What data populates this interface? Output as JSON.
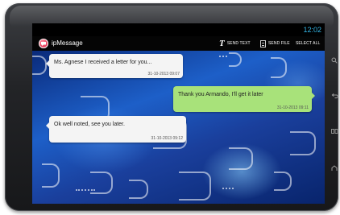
{
  "status_bar": {
    "time": "12:02"
  },
  "action_bar": {
    "title": "ipMessage",
    "send_text": "SEND TEXT",
    "send_file": "SEND FILE",
    "select_all": "SELECT ALL"
  },
  "messages": [
    {
      "direction": "incoming",
      "text": "Ms. Agnese I received a letter for you...",
      "time": "31-10-2013  09:07"
    },
    {
      "direction": "outgoing",
      "text": "Thank you Armando, I'll get it later",
      "time": "31-10-2013  09:11"
    },
    {
      "direction": "incoming",
      "text": "Ok well noted, see you later.",
      "time": "31-10-2013  09:12"
    }
  ],
  "colors": {
    "incoming_bubble": "#f4f4f4",
    "outgoing_bubble": "#a8e27a",
    "status_accent": "#33b5e5",
    "app_icon": "#e0324f"
  },
  "icons": {
    "app": "ipmessage-logo-icon",
    "send_text": "text-T-icon",
    "send_file": "file-icon",
    "hw_keys": [
      "search-icon",
      "back-icon",
      "recent-apps-icon",
      "home-icon"
    ]
  }
}
